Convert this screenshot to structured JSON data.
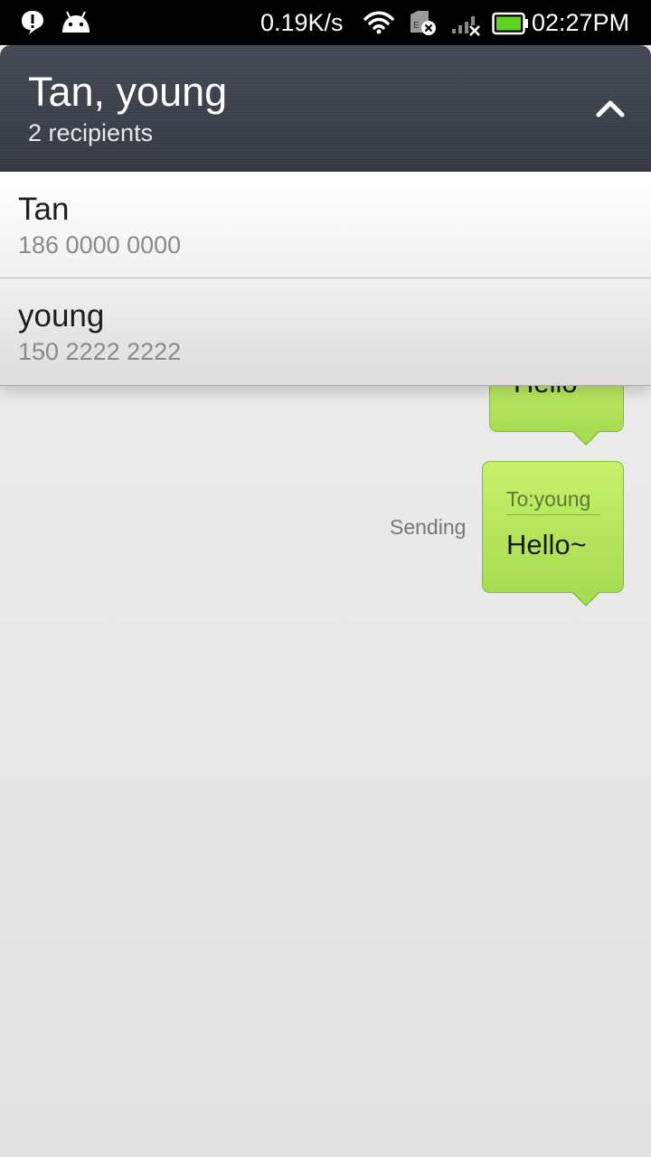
{
  "status_bar": {
    "icons_left": [
      "alert-icon",
      "android-icon"
    ],
    "network_speed": "0.19K/s",
    "icons_right": [
      "wifi-icon",
      "sim-error-icon",
      "signal-icon",
      "battery-icon"
    ],
    "time": "02:27PM",
    "battery_color": "#5fd324"
  },
  "header": {
    "title": "Tan, young",
    "subtitle": "2 recipients",
    "collapse_icon": "chevron-up-icon"
  },
  "recipients": [
    {
      "name": "Tan",
      "number": "186 0000 0000"
    },
    {
      "name": "young",
      "number": "150 2222 2222"
    }
  ],
  "messages": [
    {
      "text": "Hello",
      "partially_hidden": true
    },
    {
      "to": "To:young",
      "text": "Hello~",
      "status": "Sending"
    }
  ],
  "colors": {
    "header_bg": "#3c414b",
    "bubble_green": "#b8e55e",
    "bubble_border": "#86bb3a"
  }
}
